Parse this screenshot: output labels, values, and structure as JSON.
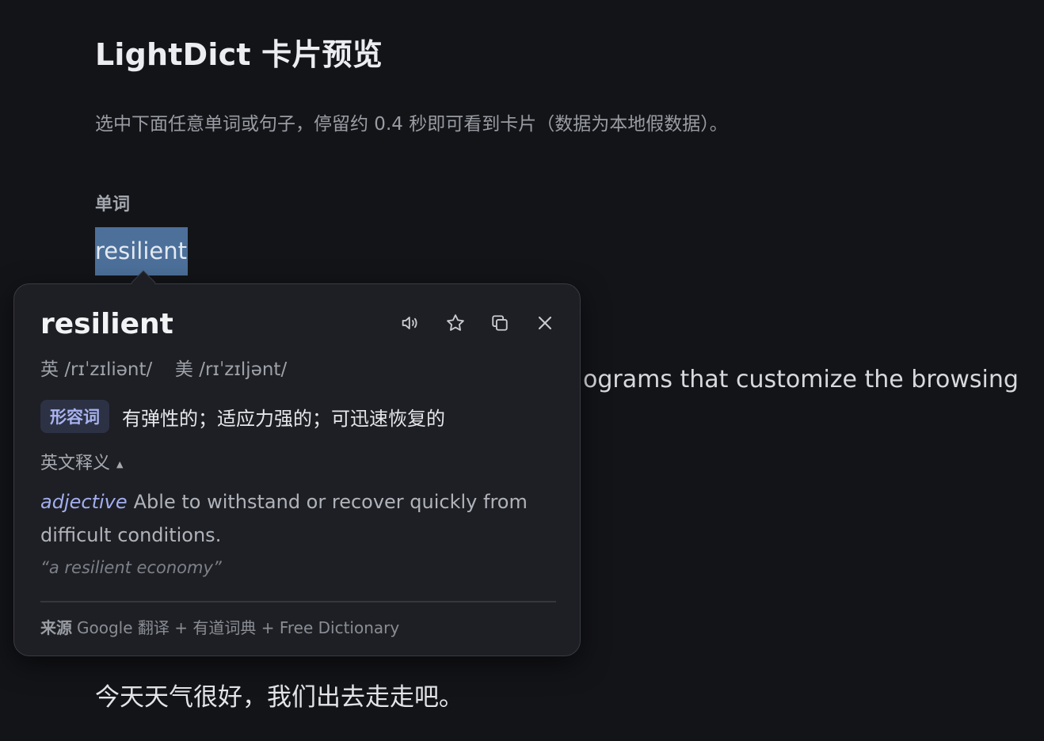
{
  "page": {
    "title": "LightDict 卡片预览",
    "intro": "选中下面任意单词或句子，停留约 0.4 秒即可看到卡片（数据为本地假数据）。",
    "section_word_label": "单词",
    "selected_word": "resilient",
    "body_sentence_fragment": "ograms that customize the browsing",
    "chinese_sentence": "今天天气很好，我们出去走走吧。"
  },
  "card": {
    "word": "resilient",
    "phonetic_uk_label": "英",
    "phonetic_uk": "/rɪˈzɪliənt/",
    "phonetic_us_label": "美",
    "phonetic_us": "/rɪˈzɪljənt/",
    "pos_badge": "形容词",
    "definition_cn": "有弹性的；适应力强的；可迅速恢复的",
    "english_toggle_label": "英文释义",
    "english_toggle_caret": "▲",
    "english_pos": "adjective",
    "english_definition": "Able to withstand or recover quickly from difficult conditions.",
    "example": "“a resilient economy”",
    "source_label": "来源",
    "source_text": "Google 翻译 + 有道词典 + Free Dictionary",
    "icons": [
      "speaker-icon",
      "star-icon",
      "copy-icon",
      "close-icon"
    ]
  },
  "colors": {
    "background": "#131418",
    "card_background": "#1d1f24",
    "selection": "#4c709a",
    "accent": "#a3aef0"
  }
}
